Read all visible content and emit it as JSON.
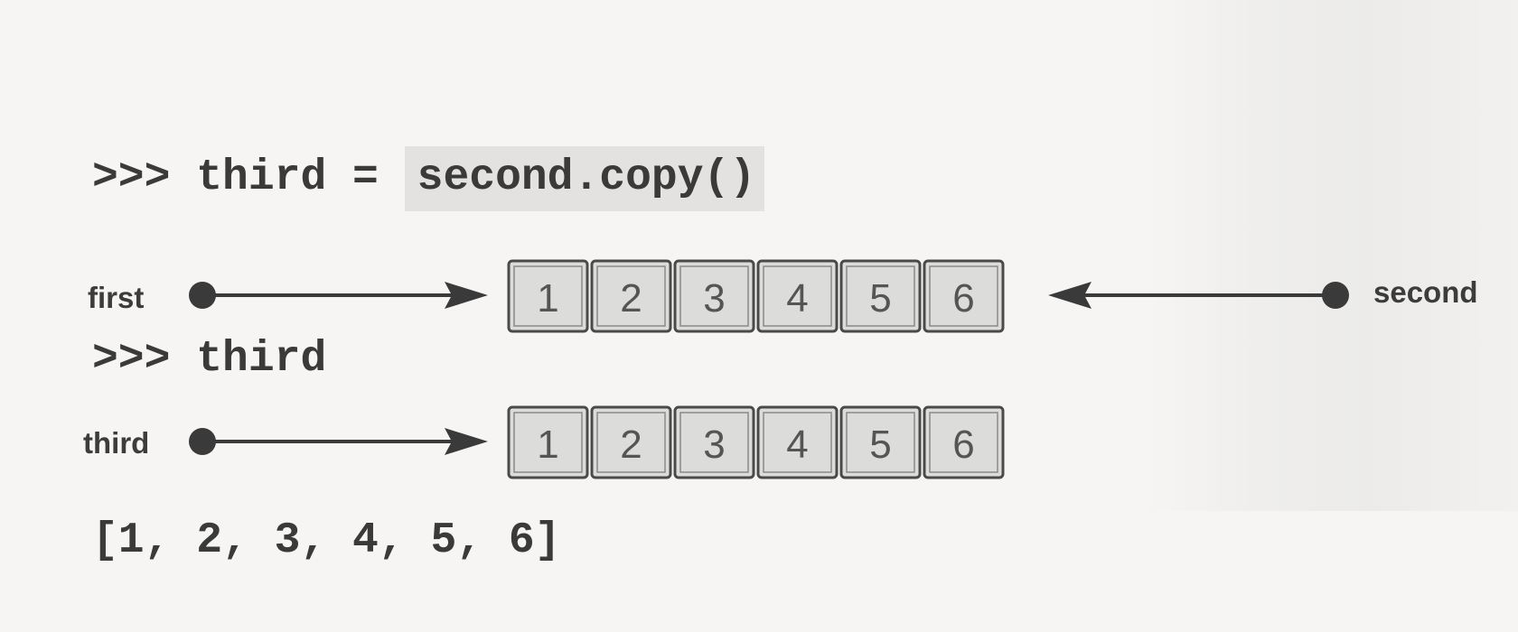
{
  "code": {
    "lines": [
      {
        "prompt": ">>> ",
        "code": "third = ",
        "highlight": "second.copy()"
      },
      {
        "prompt": ">>> ",
        "code": "third",
        "highlight": ""
      },
      {
        "prompt": "",
        "code": "[1, 2, 3, 4, 5, 6]",
        "highlight": ""
      }
    ]
  },
  "diagram": {
    "labels": {
      "first": "first",
      "second": "second",
      "third": "third"
    },
    "list_top": [
      "1",
      "2",
      "3",
      "4",
      "5",
      "6"
    ],
    "list_bottom": [
      "1",
      "2",
      "3",
      "4",
      "5",
      "6"
    ],
    "colors": {
      "arrow": "#3a3a3a",
      "cell_fill": "#dcdcda",
      "cell_border": "#4a4a4a"
    }
  }
}
